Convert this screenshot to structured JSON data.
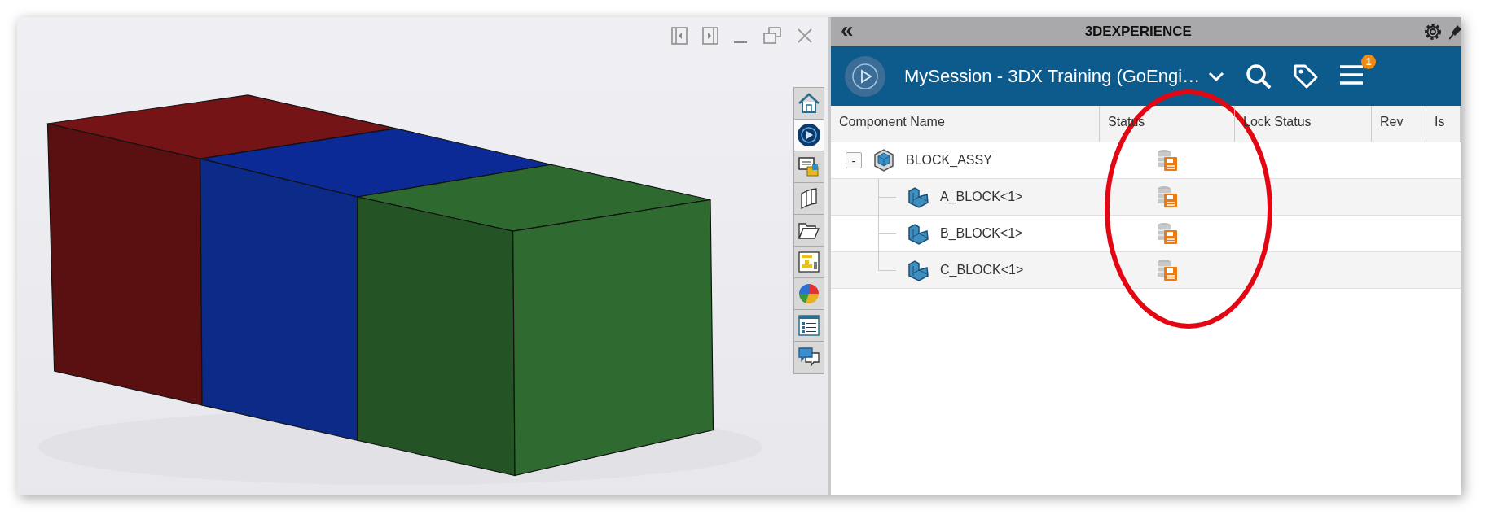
{
  "side_toolbar": [
    {
      "selected": false
    },
    {
      "selected": true
    },
    {
      "selected": false
    },
    {
      "selected": false
    },
    {
      "selected": false
    },
    {
      "selected": false
    },
    {
      "selected": false
    },
    {
      "selected": false
    },
    {
      "selected": false
    }
  ],
  "panel": {
    "collapse_glyph": "«",
    "title": "3DEXPERIENCE",
    "session": "MySession - 3DX Training (GoEngi…",
    "notification_count": "1"
  },
  "table": {
    "columns": [
      "Component Name",
      "Status",
      "Lock Status",
      "Rev",
      "Is"
    ],
    "rows": [
      {
        "name": "BLOCK_ASSY",
        "kind": "assembly",
        "expand_toggle": "-",
        "expanded": true,
        "children": [
          {
            "name": "A_BLOCK<1>",
            "kind": "part"
          },
          {
            "name": "B_BLOCK<1>",
            "kind": "part"
          },
          {
            "name": "C_BLOCK<1>",
            "kind": "part"
          }
        ]
      }
    ]
  }
}
